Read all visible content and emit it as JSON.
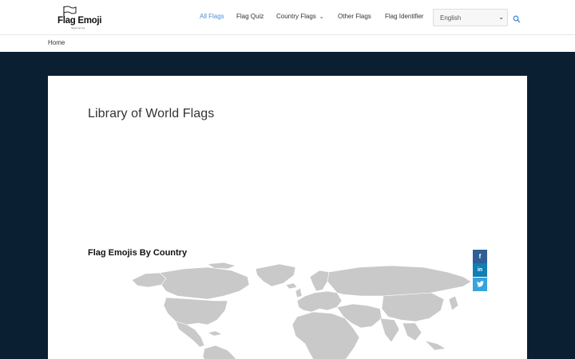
{
  "header": {
    "logo_text": "Flag Emoji",
    "logo_sub": "flagemoji.org",
    "nav": [
      {
        "label": "All Flags",
        "active": true
      },
      {
        "label": "Flag Quiz",
        "active": false
      },
      {
        "label": "Country Flags",
        "active": false,
        "has_dropdown": true
      },
      {
        "label": "Other Flags",
        "active": false
      },
      {
        "label": "Flag Identifier",
        "active": false
      }
    ],
    "language": {
      "selected": "English"
    },
    "search_icon": "search-icon"
  },
  "breadcrumb": {
    "home": "Home"
  },
  "main": {
    "title": "Library of World Flags",
    "section_title": "Flag Emojis By Country"
  },
  "share": [
    {
      "label": "f",
      "icon": "facebook-icon"
    },
    {
      "label": "in",
      "icon": "linkedin-icon"
    },
    {
      "label": "t",
      "icon": "twitter-icon"
    }
  ],
  "colors": {
    "accent": "#4a8fd3",
    "dark_background": "#0b1f33",
    "map_land": "#c9c9c9",
    "facebook": "#2f5f95",
    "linkedin": "#0f7fb4",
    "twitter": "#36a3df"
  }
}
